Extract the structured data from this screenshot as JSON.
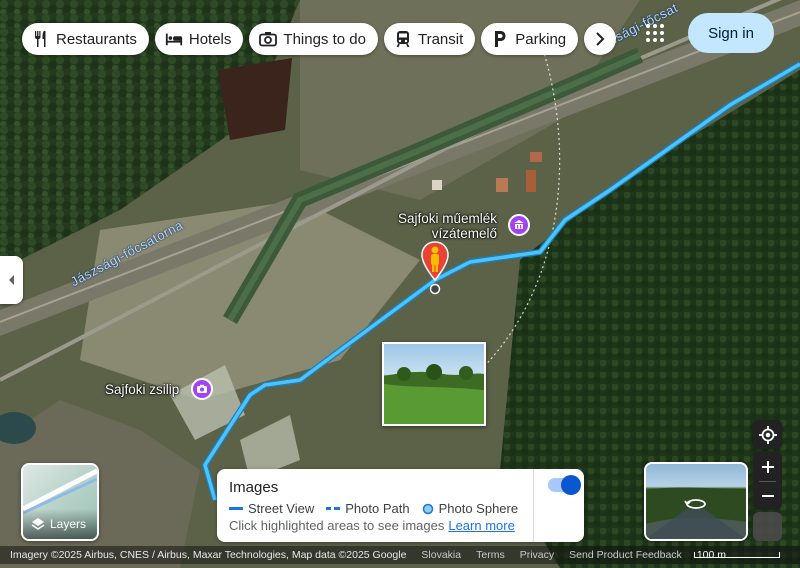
{
  "chips": [
    {
      "label": "Restaurants",
      "icon": "fork-knife-icon"
    },
    {
      "label": "Hotels",
      "icon": "bed-icon"
    },
    {
      "label": "Things to do",
      "icon": "camera-icon"
    },
    {
      "label": "Transit",
      "icon": "train-icon"
    },
    {
      "label": "Parking",
      "icon": "parking-icon"
    }
  ],
  "header": {
    "signin_label": "Sign in"
  },
  "map_labels": {
    "poi_1_line1": "Sajfoki műemlék",
    "poi_1_line2": "vízátemelő",
    "poi_2": "Sajfoki zsilip",
    "canal": "Jászsági-főcsatorna",
    "canal_top": "Jászsági-főcsat"
  },
  "layers": {
    "label": "Layers"
  },
  "images_panel": {
    "title": "Images",
    "legend_street_view": "Street View",
    "legend_photo_path": "Photo Path",
    "legend_photo_sphere": "Photo Sphere",
    "hint": "Click highlighted areas to see images",
    "learn_more": "Learn more",
    "toggle_on": true
  },
  "footer": {
    "imagery": "Imagery ©2025 Airbus, CNES / Airbus, Maxar Technologies, Map data ©2025 Google",
    "country": "Slovakia",
    "terms": "Terms",
    "privacy": "Privacy",
    "feedback": "Send Product Feedback",
    "scale": "100 m"
  },
  "colors": {
    "route": "#3fb4f2",
    "poi": "#a142f4",
    "signin_bg": "#c2e7ff"
  }
}
